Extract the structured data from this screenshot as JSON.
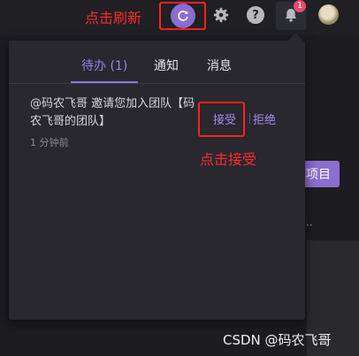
{
  "annotations": {
    "refresh": "点击刷新",
    "accept": "点击接受"
  },
  "header": {
    "icons": [
      "refresh-icon",
      "gear-icon",
      "help-icon",
      "bell-icon",
      "avatar"
    ],
    "help_label": "?",
    "notification_badge": "1"
  },
  "notifications": {
    "tabs": [
      {
        "label": "待办 (1)",
        "active": true
      },
      {
        "label": "通知",
        "active": false
      },
      {
        "label": "消息",
        "active": false
      }
    ],
    "items": [
      {
        "text": "@码农飞哥 邀请您加入团队【码农飞哥的团队】",
        "time": "1 分钟前",
        "accept_label": "接受",
        "reject_label": "拒绝"
      }
    ]
  },
  "background": {
    "button_label": "项目",
    "dots": "··"
  },
  "watermark": "CSDN @码农飞哥",
  "colors": {
    "accent": "#8b6cd0",
    "annotation": "#ff2a2a",
    "badge": "#e7486c",
    "panel": "#28282e"
  }
}
